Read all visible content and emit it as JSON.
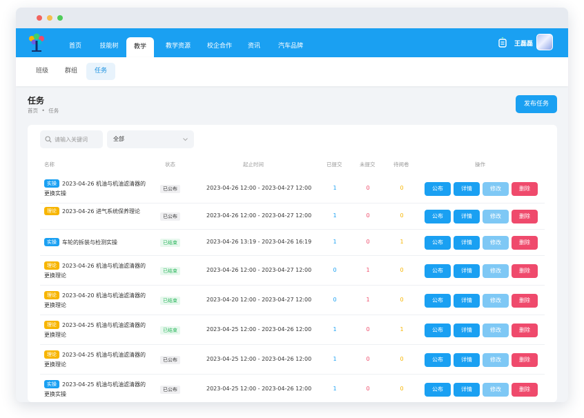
{
  "nav": {
    "items": [
      {
        "label": "首页",
        "active": false
      },
      {
        "label": "技能树",
        "active": false
      },
      {
        "label": "教学",
        "active": true
      },
      {
        "label": "教学资源",
        "active": false
      },
      {
        "label": "校企合作",
        "active": false
      },
      {
        "label": "资讯",
        "active": false
      },
      {
        "label": "汽车品牌",
        "active": false
      }
    ],
    "user_name": "王磊磊"
  },
  "subnav": {
    "items": [
      {
        "label": "班级",
        "active": false
      },
      {
        "label": "群组",
        "active": false
      },
      {
        "label": "任务",
        "active": true
      }
    ]
  },
  "page": {
    "title": "任务",
    "breadcrumb": [
      "首页",
      "任务"
    ],
    "breadcrumb_sep": "•",
    "publish_button": "发布任务"
  },
  "filters": {
    "search_placeholder": "请输入关键词",
    "search_value": "",
    "select_value": "全部"
  },
  "table": {
    "headers": {
      "name": "名称",
      "status": "状态",
      "deadline": "起止时间",
      "submitted": "已提交",
      "unsubmitted": "未提交",
      "pending": "待阅卷",
      "actions": "操作"
    },
    "action_labels": {
      "publish": "公布",
      "detail": "详情",
      "edit": "修改",
      "delete": "删除"
    },
    "rows": [
      {
        "type": "实操",
        "type_kind": "shixun",
        "name": "2023-04-26 机油与机油滤清器的更换实操",
        "status": "已公布",
        "status_kind": "pub",
        "time": "2023-04-26 12:00 - 2023-04-27 12:00",
        "submitted": "1",
        "unsubmitted": "0",
        "pending": "0"
      },
      {
        "type": "理论",
        "type_kind": "lilun",
        "name": "2023-04-26 进气系统保养理论",
        "status": "已公布",
        "status_kind": "pub",
        "time": "2023-04-26 12:00 - 2023-04-27 12:00",
        "submitted": "1",
        "unsubmitted": "0",
        "pending": "0"
      },
      {
        "type": "实操",
        "type_kind": "shixun",
        "name": "车轮的拆装与检测实操",
        "status": "已结束",
        "status_kind": "end",
        "time": "2023-04-26 13:19 - 2023-04-26 16:19",
        "submitted": "1",
        "unsubmitted": "0",
        "pending": "1"
      },
      {
        "type": "理论",
        "type_kind": "lilun",
        "name": "2023-04-26 机油与机油滤清器的更换理论",
        "status": "已结束",
        "status_kind": "end",
        "time": "2023-04-26 12:00 - 2023-04-27 12:00",
        "submitted": "0",
        "unsubmitted": "1",
        "pending": "0"
      },
      {
        "type": "理论",
        "type_kind": "lilun",
        "name": "2023-04-20 机油与机油滤清器的更换理论",
        "status": "已结束",
        "status_kind": "end",
        "time": "2023-04-20 12:00 - 2023-04-27 12:00",
        "submitted": "0",
        "unsubmitted": "1",
        "pending": "0"
      },
      {
        "type": "理论",
        "type_kind": "lilun",
        "name": "2023-04-25 机油与机油滤清器的更换理论",
        "status": "已结束",
        "status_kind": "end",
        "time": "2023-04-25 12:00 - 2023-04-26 12:00",
        "submitted": "1",
        "unsubmitted": "0",
        "pending": "1"
      },
      {
        "type": "理论",
        "type_kind": "lilun",
        "name": "2023-04-25 机油与机油滤清器的更换理论",
        "status": "已公布",
        "status_kind": "pub",
        "time": "2023-04-25 12:00 - 2023-04-26 12:00",
        "submitted": "1",
        "unsubmitted": "0",
        "pending": "0"
      },
      {
        "type": "实操",
        "type_kind": "shixun",
        "name": "2023-04-25 机油与机油滤清器的更换实操",
        "status": "已公布",
        "status_kind": "pub",
        "time": "2023-04-25 12:00 - 2023-04-26 12:00",
        "submitted": "1",
        "unsubmitted": "0",
        "pending": "0"
      }
    ]
  }
}
